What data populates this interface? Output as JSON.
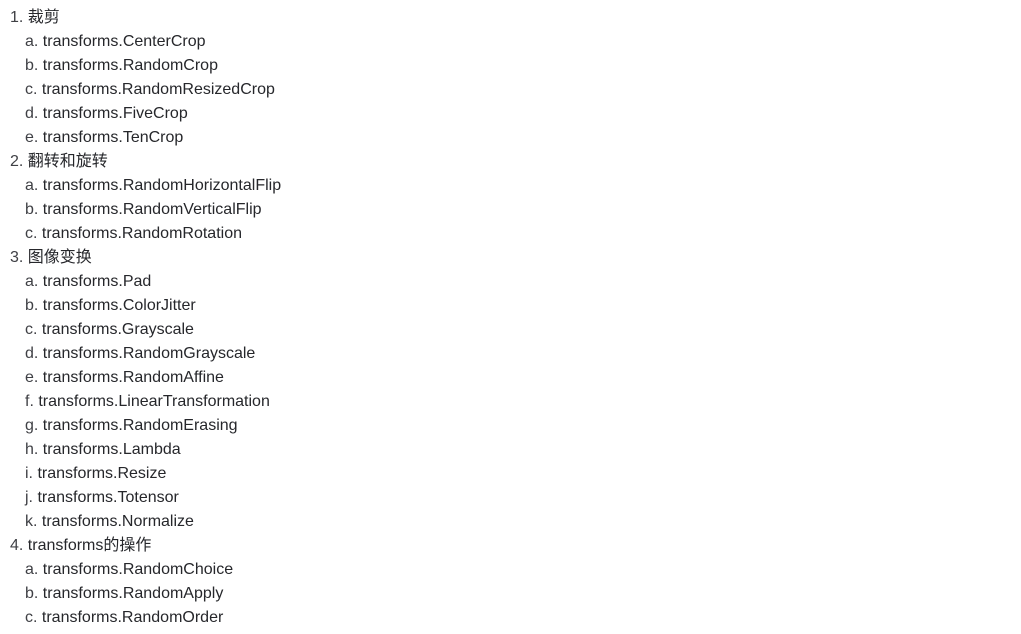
{
  "document": {
    "type": "nested-ordered-list",
    "text_color": "#26272b",
    "marker_color": "#3f4045",
    "background_color": "#ffffff",
    "outline": [
      {
        "marker": "1.",
        "label": "裁剪",
        "children": [
          {
            "marker": "a.",
            "label": "transforms.CenterCrop"
          },
          {
            "marker": "b.",
            "label": "transforms.RandomCrop"
          },
          {
            "marker": "c.",
            "label": "transforms.RandomResizedCrop"
          },
          {
            "marker": "d.",
            "label": "transforms.FiveCrop"
          },
          {
            "marker": "e.",
            "label": "transforms.TenCrop"
          }
        ]
      },
      {
        "marker": "2.",
        "label": "翻转和旋转",
        "children": [
          {
            "marker": "a.",
            "label": "transforms.RandomHorizontalFlip"
          },
          {
            "marker": "b.",
            "label": "transforms.RandomVerticalFlip"
          },
          {
            "marker": "c.",
            "label": "transforms.RandomRotation"
          }
        ]
      },
      {
        "marker": "3.",
        "label": "图像变换",
        "children": [
          {
            "marker": "a.",
            "label": "transforms.Pad"
          },
          {
            "marker": "b.",
            "label": "transforms.ColorJitter"
          },
          {
            "marker": "c.",
            "label": "transforms.Grayscale"
          },
          {
            "marker": "d.",
            "label": "transforms.RandomGrayscale"
          },
          {
            "marker": "e.",
            "label": "transforms.RandomAffine"
          },
          {
            "marker": "f.",
            "label": "transforms.LinearTransformation"
          },
          {
            "marker": "g.",
            "label": "transforms.RandomErasing"
          },
          {
            "marker": "h.",
            "label": "transforms.Lambda"
          },
          {
            "marker": "i.",
            "label": "transforms.Resize"
          },
          {
            "marker": "j.",
            "label": "transforms.Totensor"
          },
          {
            "marker": "k.",
            "label": "transforms.Normalize"
          }
        ]
      },
      {
        "marker": "4.",
        "label": "transforms的操作",
        "children": [
          {
            "marker": "a.",
            "label": "transforms.RandomChoice"
          },
          {
            "marker": "b.",
            "label": "transforms.RandomApply"
          },
          {
            "marker": "c.",
            "label": "transforms.RandomOrder"
          }
        ]
      }
    ]
  }
}
